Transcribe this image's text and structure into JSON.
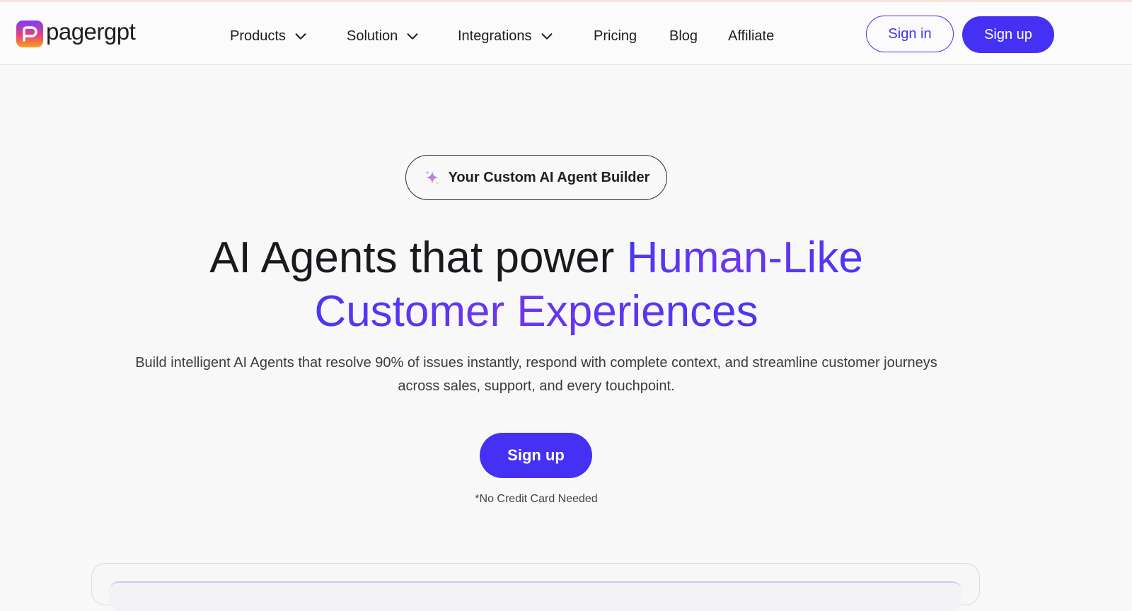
{
  "brand": {
    "name": "pagergpt",
    "logo_gradient": [
      "#7b3cf5",
      "#e9407a",
      "#f7a21b"
    ]
  },
  "nav": {
    "items": [
      {
        "label": "Products",
        "has_dropdown": true
      },
      {
        "label": "Solution",
        "has_dropdown": true
      },
      {
        "label": "Integrations",
        "has_dropdown": true
      },
      {
        "label": "Pricing",
        "has_dropdown": false
      },
      {
        "label": "Blog",
        "has_dropdown": false
      },
      {
        "label": "Affiliate",
        "has_dropdown": false
      }
    ],
    "signin_label": "Sign in",
    "signup_label": "Sign up"
  },
  "hero": {
    "badge_icon": "sparkle-icon",
    "badge_text": "Your Custom AI Agent Builder",
    "title_plain": "AI Agents that power ",
    "title_highlight_1": "Human-Like",
    "title_highlight_2": "Customer Experiences",
    "subtitle": "Build intelligent AI Agents that resolve 90% of issues instantly, respond with complete context, and streamline customer journeys across sales, support, and every touchpoint.",
    "cta_label": "Sign up",
    "note": "*No Credit Card Needed"
  },
  "colors": {
    "accent": "#4531f3",
    "accent_purple": "#6d36f0",
    "background": "#f8f8f9"
  }
}
